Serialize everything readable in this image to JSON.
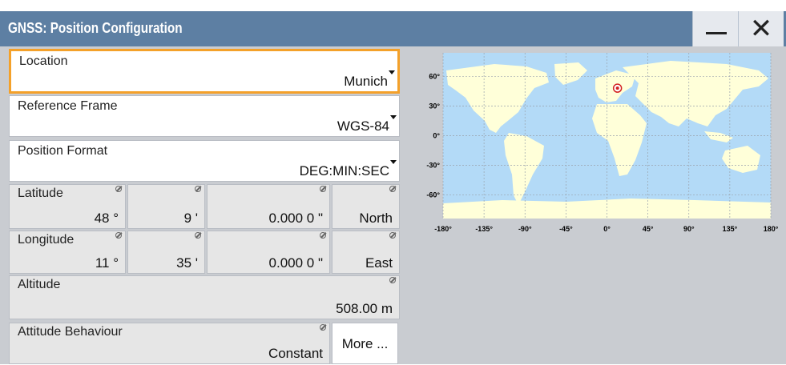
{
  "window": {
    "title": "GNSS: Position Configuration",
    "minimize_label": "—",
    "close_label": "✕"
  },
  "location": {
    "label": "Location",
    "value": "Munich"
  },
  "reference_frame": {
    "label": "Reference Frame",
    "value": "WGS-84"
  },
  "position_format": {
    "label": "Position Format",
    "value": "DEG:MIN:SEC"
  },
  "latitude": {
    "label": "Latitude",
    "deg": "48 °",
    "min": "9 '",
    "sec": "0.000 0 \"",
    "dir": "North"
  },
  "longitude": {
    "label": "Longitude",
    "deg": "11 °",
    "min": "35 '",
    "sec": "0.000 0 \"",
    "dir": "East"
  },
  "altitude": {
    "label": "Altitude",
    "value": "508.00 m"
  },
  "attitude": {
    "label": "Attitude Behaviour",
    "value": "Constant"
  },
  "more_label": "More ...",
  "map": {
    "y_ticks": [
      "60°",
      "30°",
      "0°",
      "-30°",
      "-60°"
    ],
    "x_ticks": [
      "-180°",
      "-135°",
      "-90°",
      "-45°",
      "0°",
      "45°",
      "90°",
      "135°",
      "180°"
    ],
    "marker": {
      "lat": 48.15,
      "lon": 11.58
    },
    "colors": {
      "ocean": "#b3daf7",
      "land": "#ffffd9",
      "marker": "#d22020"
    }
  }
}
